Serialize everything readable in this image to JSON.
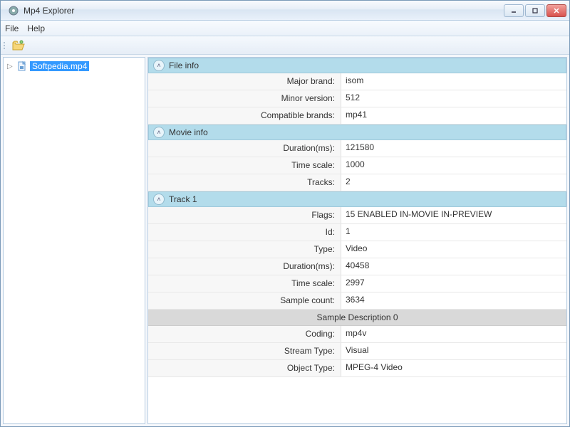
{
  "window": {
    "title": "Mp4 Explorer"
  },
  "menu": {
    "file": "File",
    "help": "Help"
  },
  "tree": {
    "item": "Softpedia.mp4"
  },
  "sections": {
    "file_info": {
      "title": "File info",
      "rows": [
        {
          "key": "Major brand:",
          "val": "isom"
        },
        {
          "key": "Minor version:",
          "val": "512"
        },
        {
          "key": "Compatible brands:",
          "val": "mp41"
        }
      ]
    },
    "movie_info": {
      "title": "Movie info",
      "rows": [
        {
          "key": "Duration(ms):",
          "val": "121580"
        },
        {
          "key": "Time scale:",
          "val": "1000"
        },
        {
          "key": "Tracks:",
          "val": "2"
        }
      ]
    },
    "track1": {
      "title": "Track 1",
      "rows": [
        {
          "key": "Flags:",
          "val": "15 ENABLED IN-MOVIE IN-PREVIEW"
        },
        {
          "key": "Id:",
          "val": "1"
        },
        {
          "key": "Type:",
          "val": "Video"
        },
        {
          "key": "Duration(ms):",
          "val": "40458"
        },
        {
          "key": "Time scale:",
          "val": "2997"
        },
        {
          "key": "Sample count:",
          "val": "3634"
        }
      ],
      "subheader": "Sample Description 0",
      "subrows": [
        {
          "key": "Coding:",
          "val": "mp4v"
        },
        {
          "key": "Stream Type:",
          "val": "Visual"
        },
        {
          "key": "Object Type:",
          "val": "MPEG-4 Video"
        }
      ]
    }
  }
}
